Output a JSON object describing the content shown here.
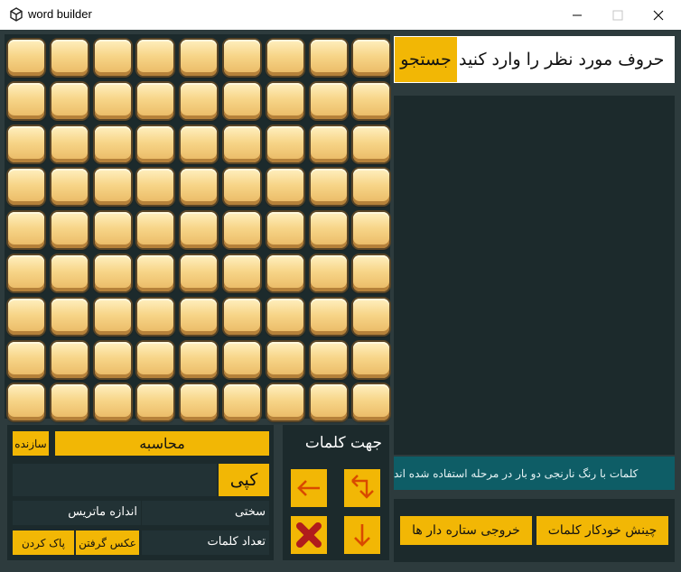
{
  "window": {
    "title": "word builder",
    "minimize_icon": "minimize-icon",
    "maximize_icon": "maximize-icon",
    "close_icon": "close-icon"
  },
  "grid": {
    "rows": 9,
    "cols": 9
  },
  "search": {
    "prompt": "حروف مورد نظر را وارد کنید",
    "button": "جستجو"
  },
  "notice": "کلمات با رنگ نارنجی دو بار در مرحله استفاده شده اند",
  "bottom_right": {
    "auto_arrange": "چینش خودکار کلمات",
    "star_output": "خروجی ستاره دار ها"
  },
  "controls": {
    "creator": "سازنده",
    "compute": "محاسبه",
    "copy": "کپی",
    "matrix_size": "اندازه ماتریس",
    "difficulty": "سختی",
    "word_count": "تعداد کلمات",
    "clear": "پاک کردن",
    "screenshot": "عکس گرفتن"
  },
  "directions": {
    "title": "جهت کلمات",
    "icons": [
      "diagonal-arrow-icon",
      "left-arrow-icon",
      "down-arrow-icon",
      "cross-icon"
    ]
  },
  "colors": {
    "accent": "#f2b705",
    "background": "#2d3b3d",
    "panel": "#1c2a2c",
    "notice_bg": "#0e5d66",
    "cross": "#b01c1c",
    "arrow": "#d94a00"
  }
}
